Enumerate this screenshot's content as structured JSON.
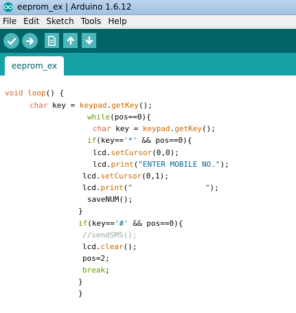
{
  "window": {
    "title": "eeprom_ex | Arduino 1.6.12",
    "app_icon": "arduino-infinity-logo"
  },
  "menu": {
    "items": [
      "File",
      "Edit",
      "Sketch",
      "Tools",
      "Help"
    ]
  },
  "toolbar": {
    "buttons": [
      {
        "name": "verify",
        "icon": "checkmark-icon"
      },
      {
        "name": "upload",
        "icon": "arrow-right-icon"
      },
      {
        "name": "new",
        "icon": "new-file-icon"
      },
      {
        "name": "open",
        "icon": "arrow-up-icon"
      },
      {
        "name": "save",
        "icon": "arrow-down-icon"
      }
    ]
  },
  "tabs": [
    {
      "label": "eeprom_ex",
      "active": true
    }
  ],
  "colors": {
    "toolbar_bg": "#006468",
    "tabstrip_bg": "#17a1a5",
    "button_bg": "#4db7bb",
    "type_keyword": "#cc6633",
    "control_keyword": "#669900",
    "function_name": "#cc6600",
    "string_literal": "#006699",
    "comment": "#95a5a6"
  },
  "code": {
    "lines": [
      "void loop() {",
      "char key = keypad.getKey();",
      "while(pos==0){",
      "char key = keypad.getKey();",
      "if(key=='*' && pos==0){",
      "lcd.setCursor(0,0);",
      "lcd.print(\"ENTER MOBILE NO.\");",
      "lcd.setCursor(0,1);",
      "lcd.print(\"                \");",
      "saveNUM();",
      "}",
      "if(key=='#' && pos==0){",
      "//sendSMS();",
      "lcd.clear();",
      "pos=2;",
      "break;",
      "}",
      "}"
    ]
  }
}
